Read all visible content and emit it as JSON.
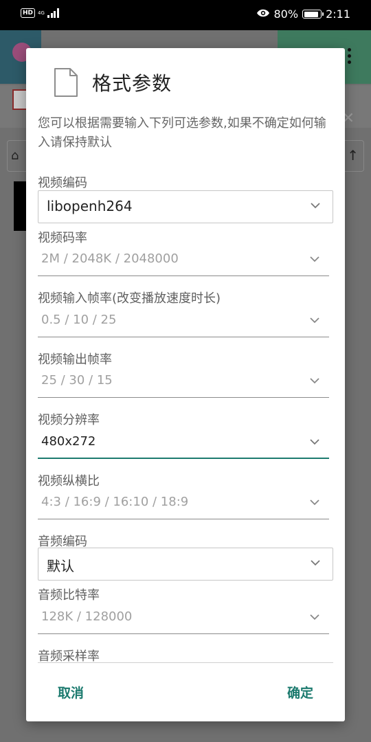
{
  "status_bar": {
    "hd_badge": "HD",
    "network": "4G",
    "battery_percent": "80%",
    "battery_level": 0.8,
    "time": "2:11",
    "icons": [
      "hd-icon",
      "signal-icon",
      "eye-icon",
      "battery-icon"
    ]
  },
  "dialog": {
    "title": "格式参数",
    "icon": "file-icon",
    "description": "您可以根据需要输入下列可选参数,如果不确定如何输入请保持默认",
    "fields": [
      {
        "label": "视频编码",
        "kind": "select",
        "value": "libopenh264",
        "placeholder": ""
      },
      {
        "label": "视频码率",
        "kind": "input",
        "value": "",
        "placeholder": "2M / 2048K / 2048000"
      },
      {
        "label": "视频输入帧率(改变播放速度时长)",
        "kind": "input",
        "value": "",
        "placeholder": "0.5 / 10 / 25"
      },
      {
        "label": "视频输出帧率",
        "kind": "input",
        "value": "",
        "placeholder": "25 / 30 / 15"
      },
      {
        "label": "视频分辨率",
        "kind": "input",
        "value": "480x272",
        "placeholder": "",
        "focused": true
      },
      {
        "label": "视频纵横比",
        "kind": "input",
        "value": "",
        "placeholder": "4:3 / 16:9 / 16:10 / 18:9"
      },
      {
        "label": "音频编码",
        "kind": "select",
        "value": "默认",
        "placeholder": ""
      },
      {
        "label": "音频比特率",
        "kind": "input",
        "value": "",
        "placeholder": "128K / 128000"
      },
      {
        "label": "音频采样率",
        "kind": "input",
        "value": "",
        "placeholder": ""
      }
    ],
    "cancel_label": "取消",
    "ok_label": "确定"
  },
  "colors": {
    "accent": "#1b7a6e",
    "label": "#5f5f5f",
    "placeholder": "#a0a0a0",
    "scrim": "#6e6e6e"
  }
}
